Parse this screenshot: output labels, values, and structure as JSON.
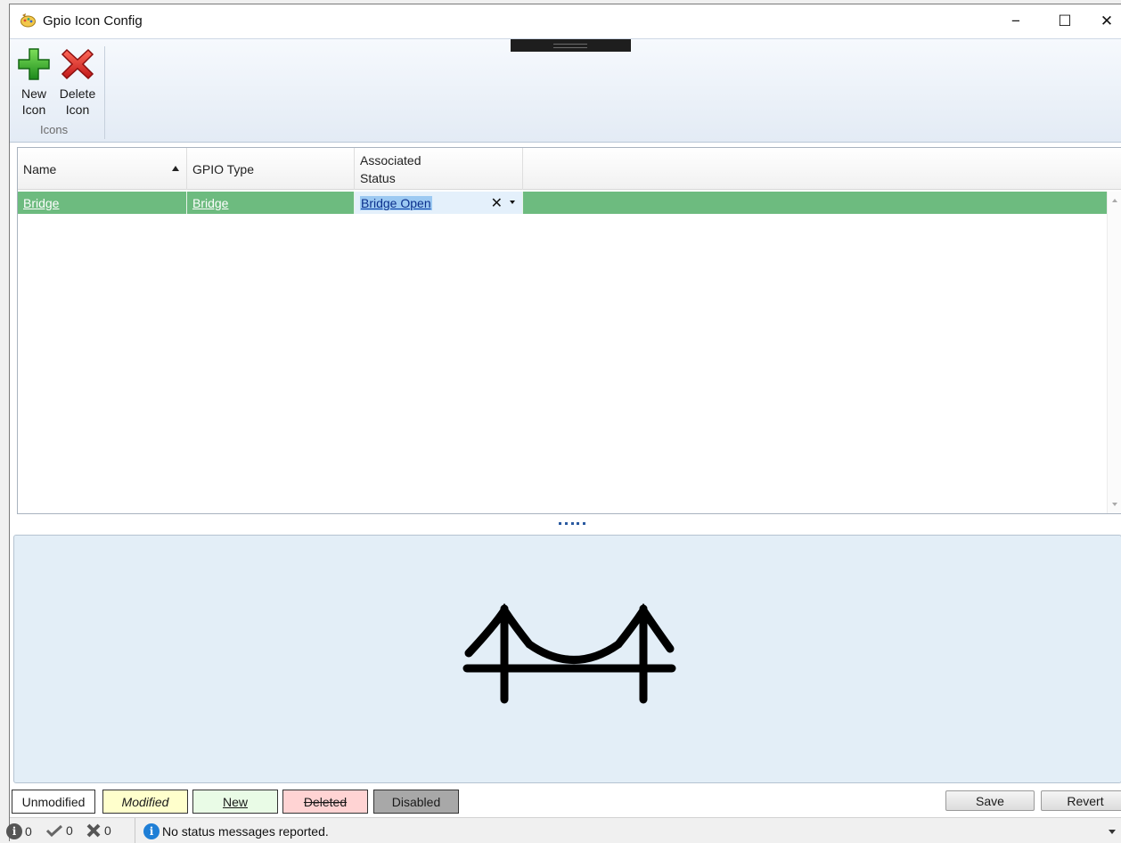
{
  "window": {
    "title": "Gpio Icon Config",
    "controls": {
      "minimize": "−",
      "maximize": "☐",
      "close": "✕"
    }
  },
  "ribbon": {
    "new_icon_label_1": "New",
    "new_icon_label_2": "Icon",
    "delete_icon_label_1": "Delete",
    "delete_icon_label_2": "Icon",
    "group_label": "Icons"
  },
  "grid": {
    "columns": [
      "Name",
      "GPIO Type",
      "Associated Status"
    ],
    "status_header_line1": "Associated",
    "status_header_line2": "Status",
    "sorted_column": "Name",
    "sort_direction": "ascending",
    "rows": [
      {
        "name": "Bridge",
        "gpio_type": "Bridge",
        "associated_status": "Bridge Open"
      }
    ],
    "clear_glyph": "✕"
  },
  "preview": {
    "icon": "bridge-icon"
  },
  "legend": {
    "unmodified": "Unmodified",
    "modified": "Modified",
    "new": "New",
    "deleted": "Deleted",
    "disabled": "Disabled"
  },
  "actions": {
    "save": "Save",
    "revert": "Revert"
  },
  "statusbar": {
    "info_count": "0",
    "ok_count": "0",
    "error_count": "0",
    "message": "No status messages reported."
  },
  "colors": {
    "selected_row": "#6dbb7f",
    "preview_bg": "#e3eef7",
    "modified": "#ffffcc",
    "new": "#e9fbe6",
    "deleted": "#ffd3d3",
    "disabled": "#a8a8a8"
  }
}
